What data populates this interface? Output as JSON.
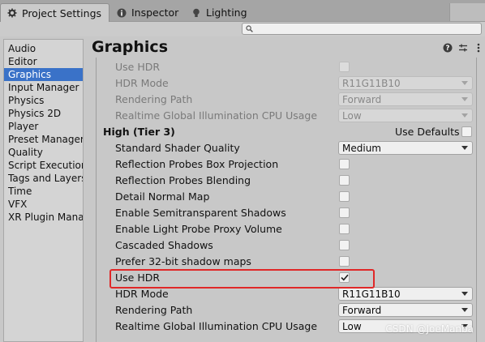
{
  "tabs": [
    {
      "label": "Project Settings",
      "icon": "gear-icon"
    },
    {
      "label": "Inspector",
      "icon": "info-icon"
    },
    {
      "label": "Lighting",
      "icon": "bulb-icon"
    }
  ],
  "search": {
    "placeholder": "",
    "value": ""
  },
  "sidebar": {
    "items": [
      "Audio",
      "Editor",
      "Graphics",
      "Input Manager",
      "Physics",
      "Physics 2D",
      "Player",
      "Preset Manager",
      "Quality",
      "Script Execution",
      "Tags and Layers",
      "Time",
      "VFX",
      "XR Plugin Management"
    ],
    "selected": "Graphics"
  },
  "main": {
    "title": "Graphics",
    "rows_medium": [
      {
        "label": "Use HDR",
        "type": "checkbox",
        "checked": false
      },
      {
        "label": "HDR Mode",
        "type": "dropdown",
        "value": "R11G11B10"
      },
      {
        "label": "Rendering Path",
        "type": "dropdown",
        "value": "Forward"
      },
      {
        "label": "Realtime Global Illumination CPU Usage",
        "type": "dropdown",
        "value": "Low"
      }
    ],
    "section_high": {
      "label": "High (Tier 3)",
      "use_defaults_label": "Use Defaults"
    },
    "rows_high": [
      {
        "label": "Standard Shader Quality",
        "type": "dropdown",
        "value": "Medium"
      },
      {
        "label": "Reflection Probes Box Projection",
        "type": "checkbox",
        "checked": false
      },
      {
        "label": "Reflection Probes Blending",
        "type": "checkbox",
        "checked": false
      },
      {
        "label": "Detail Normal Map",
        "type": "checkbox",
        "checked": false
      },
      {
        "label": "Enable Semitransparent Shadows",
        "type": "checkbox",
        "checked": false
      },
      {
        "label": "Enable Light Probe Proxy Volume",
        "type": "checkbox",
        "checked": false
      },
      {
        "label": "Cascaded Shadows",
        "type": "checkbox",
        "checked": false
      },
      {
        "label": "Prefer 32-bit shadow maps",
        "type": "checkbox",
        "checked": false
      },
      {
        "label": "Use HDR",
        "type": "checkbox",
        "checked": true
      },
      {
        "label": "HDR Mode",
        "type": "dropdown",
        "value": "R11G11B10"
      },
      {
        "label": "Rendering Path",
        "type": "dropdown",
        "value": "Forward"
      },
      {
        "label": "Realtime Global Illumination CPU Usage",
        "type": "dropdown",
        "value": "Low"
      }
    ]
  },
  "watermark": "CSDN @JoeManba",
  "colors": {
    "selection": "#3a72c8",
    "highlight": "#e02828"
  }
}
